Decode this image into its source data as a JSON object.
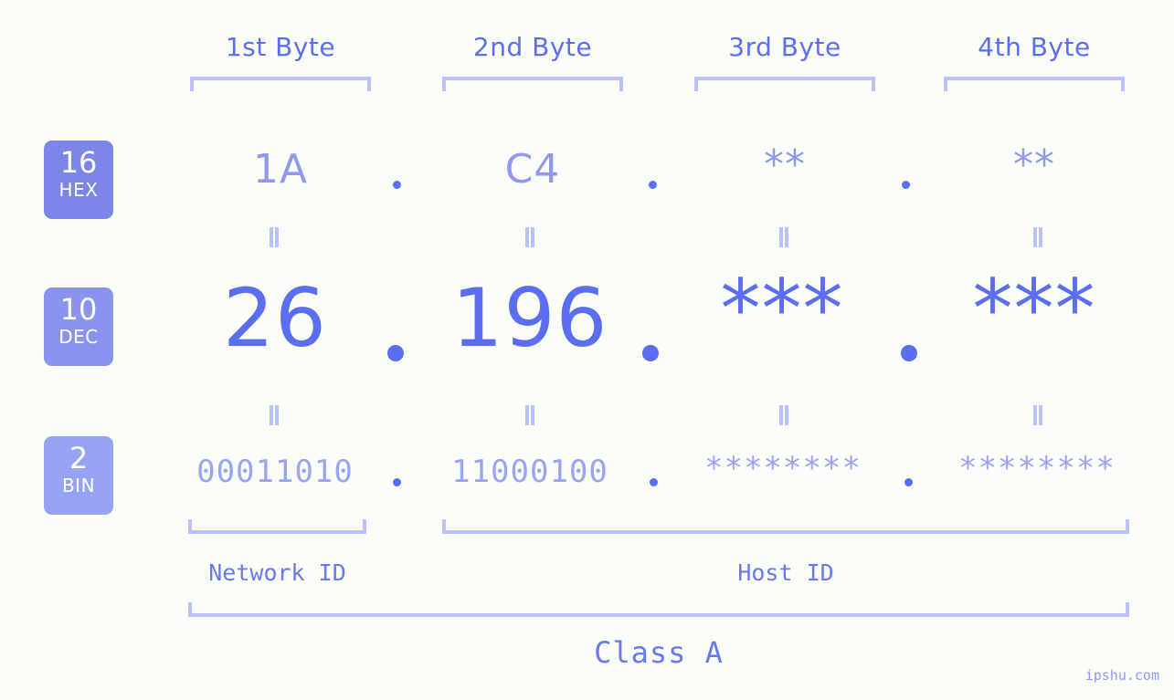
{
  "page": {
    "background_color": "#fbfdf8",
    "accent_color": "#5b6ef0",
    "accent_light_color": "#b9c2fd",
    "watermark": "ipshu.com"
  },
  "byte_headers": [
    {
      "label": "1st Byte"
    },
    {
      "label": "2nd Byte"
    },
    {
      "label": "3rd Byte"
    },
    {
      "label": "4th Byte"
    }
  ],
  "bases": [
    {
      "number": "16",
      "name": "HEX",
      "color": "#7b86e8"
    },
    {
      "number": "10",
      "name": "DEC",
      "color": "#8a93ee"
    },
    {
      "number": "2",
      "name": "BIN",
      "color": "#96a3f5"
    }
  ],
  "rows": {
    "hex": {
      "values": [
        "1A",
        "C4",
        "**",
        "**"
      ]
    },
    "dec": {
      "values": [
        "26",
        "196",
        "***",
        "***"
      ]
    },
    "bin": {
      "values": [
        "00011010",
        "11000100",
        "********",
        "********"
      ]
    }
  },
  "separators": {
    "hex": [
      ".",
      ".",
      "."
    ],
    "dec": [
      ".",
      ".",
      "."
    ],
    "bin": [
      ".",
      ".",
      "."
    ]
  },
  "equals_marks": {
    "symbol": "=",
    "count_per_row": 4,
    "rows": 2
  },
  "segments": {
    "network_id": {
      "label": "Network ID"
    },
    "host_id": {
      "label": "Host ID"
    },
    "class": {
      "label": "Class A"
    }
  }
}
